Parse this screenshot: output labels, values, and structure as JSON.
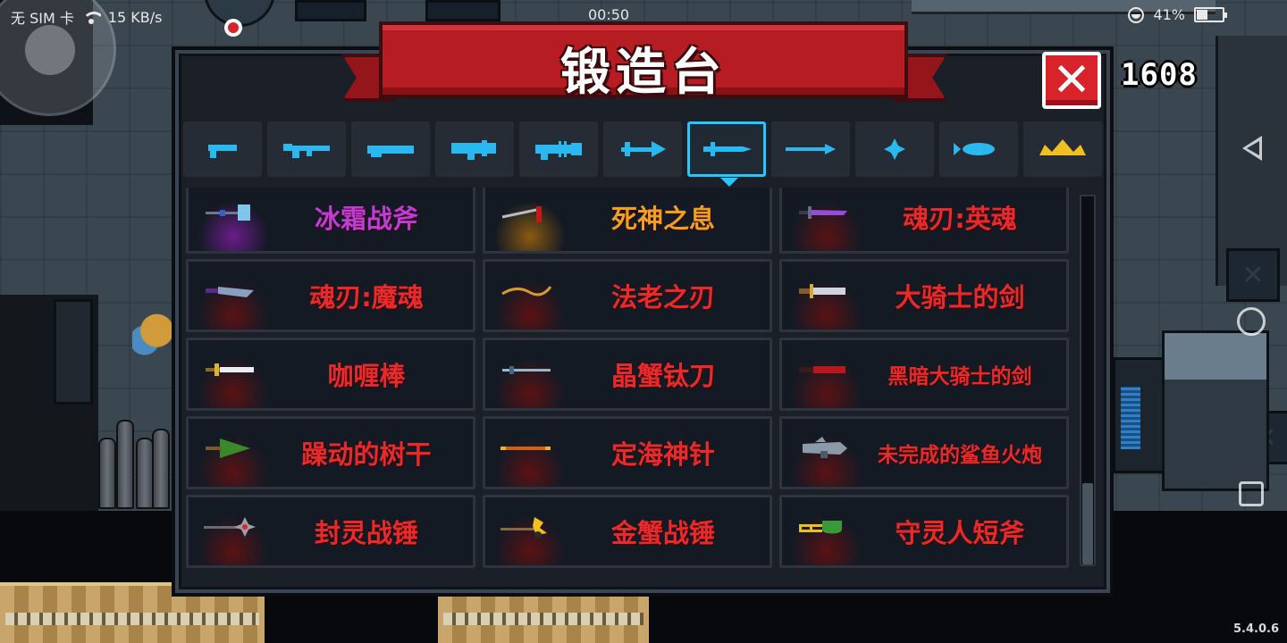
{
  "status_bar": {
    "carrier": "无 SIM 卡",
    "network_speed": "15 KB/s",
    "time": "00:50",
    "battery_percent": "41%",
    "battery_level": 0.41
  },
  "hud": {
    "gems": "1608",
    "version": "5.4.0.6"
  },
  "forge": {
    "title": "锻造台",
    "close_label": "✕",
    "active_tab_index": 6,
    "tabs": [
      {
        "id": "pistol",
        "icon": "pistol-icon"
      },
      {
        "id": "rifle",
        "icon": "rifle-icon"
      },
      {
        "id": "shotgun",
        "icon": "shotgun-icon"
      },
      {
        "id": "launcher",
        "icon": "launcher-icon"
      },
      {
        "id": "laser",
        "icon": "laser-icon"
      },
      {
        "id": "bow",
        "icon": "bow-icon"
      },
      {
        "id": "sword",
        "icon": "sword-icon"
      },
      {
        "id": "spear",
        "icon": "spear-icon"
      },
      {
        "id": "throwing",
        "icon": "shuriken-icon"
      },
      {
        "id": "fish",
        "icon": "fish-icon"
      },
      {
        "id": "special",
        "icon": "crown-icon"
      }
    ],
    "weapons": [
      {
        "name": "冰霜战斧",
        "color": "#c13cd6",
        "glow": "#6a1d8a",
        "icon": "frost-axe-icon"
      },
      {
        "name": "死神之息",
        "color": "#f0a020",
        "glow": "#8a5a10",
        "icon": "scythe-icon"
      },
      {
        "name": "魂刃:英魂",
        "color": "#e82a2a",
        "glow": "#5a1214",
        "icon": "soul-blade-icon"
      },
      {
        "name": "魂刃:魔魂",
        "color": "#e82a2a",
        "glow": "#5a1214",
        "icon": "demon-blade-icon"
      },
      {
        "name": "法老之刃",
        "color": "#e82a2a",
        "glow": "#5a1214",
        "icon": "pharaoh-blade-icon"
      },
      {
        "name": "大骑士的剑",
        "color": "#e82a2a",
        "glow": "#5a1214",
        "icon": "knight-sword-icon"
      },
      {
        "name": "咖喱棒",
        "color": "#e82a2a",
        "glow": "#5a1214",
        "icon": "excalibur-icon"
      },
      {
        "name": "晶蟹钛刀",
        "color": "#e82a2a",
        "glow": "#5a1214",
        "icon": "crab-blade-icon"
      },
      {
        "name": "黑暗大骑士的剑",
        "color": "#e82a2a",
        "glow": "#5a1214",
        "icon": "dark-sword-icon"
      },
      {
        "name": "躁动的树干",
        "color": "#e82a2a",
        "glow": "#5a1214",
        "icon": "tree-trunk-icon"
      },
      {
        "name": "定海神针",
        "color": "#e82a2a",
        "glow": "#5a1214",
        "icon": "golden-staff-icon"
      },
      {
        "name": "未完成的鲨鱼火炮",
        "color": "#e82a2a",
        "glow": "#5a1214",
        "icon": "shark-cannon-icon"
      },
      {
        "name": "封灵战锤",
        "color": "#e82a2a",
        "glow": "#5a1214",
        "icon": "spirit-hammer-icon"
      },
      {
        "name": "金蟹战锤",
        "color": "#e82a2a",
        "glow": "#5a1214",
        "icon": "crab-hammer-icon"
      },
      {
        "name": "守灵人短斧",
        "color": "#e82a2a",
        "glow": "#5a1214",
        "icon": "keeper-axe-icon"
      }
    ],
    "scroll_position": 1.0,
    "scroll_visible_fraction": 0.22
  },
  "colors": {
    "tab_icon": "#2ab8f0",
    "tab_active_border": "#22c8ff",
    "banner": "#b51d23",
    "close_button": "#d8232a"
  }
}
